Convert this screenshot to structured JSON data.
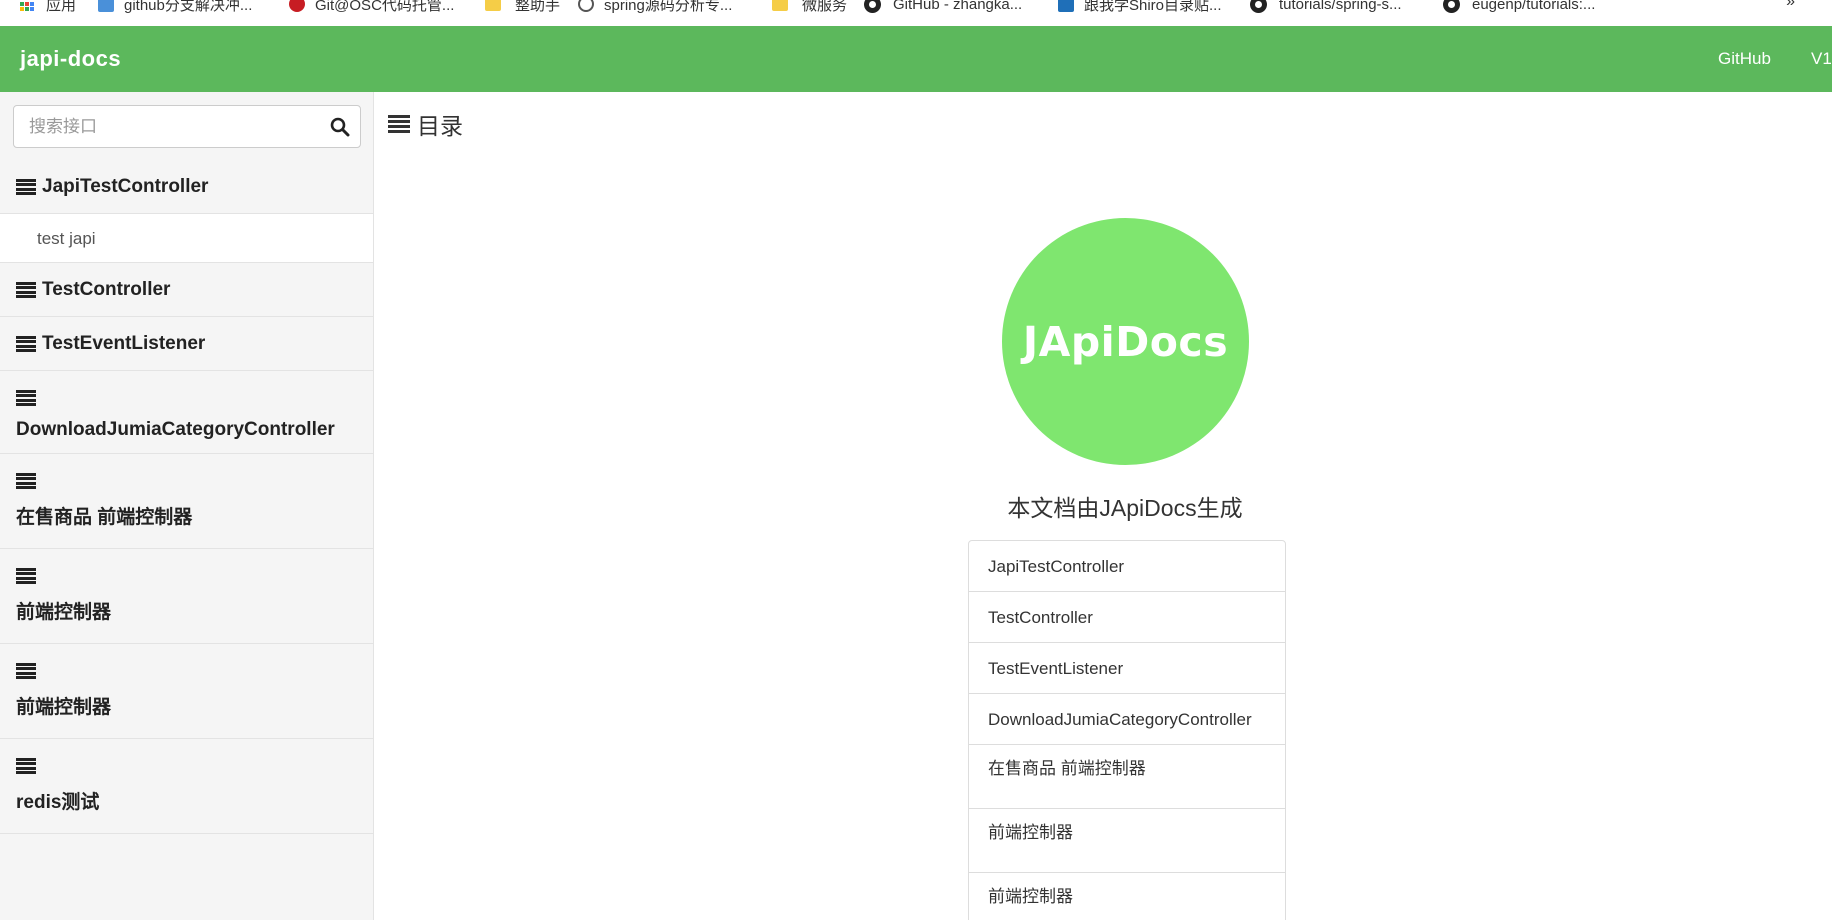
{
  "bookmarks": [
    {
      "label": "应用",
      "icon": "apps-grid-icon"
    },
    {
      "label": "github分支解决冲...",
      "icon": "translate-icon"
    },
    {
      "label": "Git@OSC代码托管...",
      "icon": "gitee-icon"
    },
    {
      "label": "整助手",
      "icon": "folder-icon"
    },
    {
      "label": "spring源码分析专...",
      "icon": "csdn-icon"
    },
    {
      "label": "微服务",
      "icon": "folder-icon"
    },
    {
      "label": "GitHub - zhangka...",
      "icon": "github-icon"
    },
    {
      "label": "跟我学Shiro目录贴...",
      "icon": "iteye-icon"
    },
    {
      "label": "tutorials/spring-s...",
      "icon": "github-icon"
    },
    {
      "label": "eugenp/tutorials:...",
      "icon": "github-icon"
    }
  ],
  "bookmarks_more": "»",
  "navbar": {
    "brand": "japi-docs",
    "links": [
      "GitHub",
      "V1"
    ],
    "color": "#5cb85c"
  },
  "search": {
    "placeholder": "搜索接口",
    "icon": "search-icon"
  },
  "sidebar": {
    "groups": [
      {
        "label": "JapiTestController",
        "items": [
          "test japi"
        ]
      },
      {
        "label": "TestController"
      },
      {
        "label": "TestEventListener"
      },
      {
        "label": "DownloadJumiaCategoryController"
      },
      {
        "label": "在售商品 前端控制器"
      },
      {
        "label": "前端控制器"
      },
      {
        "label": "前端控制器"
      },
      {
        "label": "redis测试"
      }
    ]
  },
  "main": {
    "title": "目录",
    "logo_text": "JApiDocs",
    "logo_color": "#7fe66f",
    "caption": "本文档由JApiDocs生成",
    "toc": [
      "JapiTestController",
      "TestController",
      "TestEventListener",
      "DownloadJumiaCategoryController",
      "在售商品 前端控制器",
      "前端控制器",
      "前端控制器"
    ]
  }
}
